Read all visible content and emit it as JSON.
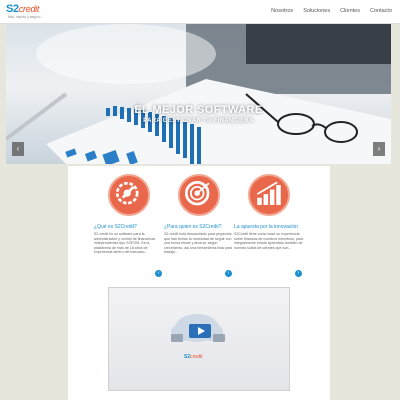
{
  "brand": {
    "logo_main": "S2",
    "logo_accent": "credit",
    "tagline": "fácil, rápido y seguro..."
  },
  "nav": {
    "items": [
      {
        "label": "Nosotros"
      },
      {
        "label": "Soluciones"
      },
      {
        "label": "Clientes"
      },
      {
        "label": "Contacto"
      }
    ]
  },
  "hero": {
    "title": "EL MEJOR SOFTWARE",
    "subtitle": "PARA GESTIONAR TU FINANCIERA",
    "slides_count": 5,
    "active_slide": 2,
    "left_arrow": "‹",
    "right_arrow": "›"
  },
  "features": [
    {
      "icon": "gear-wrench-icon",
      "title": "¿Qué es S2Credit?",
      "text": "S2 credit es un software para la administración y control de financieras independientes tipo SOFOM. Es la plataforma de más de 18 años de experiencia dentro del mercado...",
      "more": "›"
    },
    {
      "icon": "target-icon",
      "title": "¿Para quien es S2Credit?",
      "text": "S2 credit está desarrollado para proyectos que han tenido la necesidad de seguir con una forma eficaz y ahorrar, segun crecimiento, así una herramienta lista para trabajo...",
      "more": "›"
    },
    {
      "icon": "growth-chart-icon",
      "title": "La apuesta por la innovación",
      "text": "S2Credit tiene como base su experiencia sobre finanzas de nuestros miembros, para integralmente brinda aprendido también de nuestra sólida de clientes que son...",
      "more": "›"
    }
  ],
  "video": {
    "logo_main": "S2",
    "logo_accent": "credit",
    "icon": "cloud-play-icon"
  },
  "colors": {
    "brand_blue": "#1d8fd0",
    "accent_orange": "#e8502a",
    "circle_orange": "#e9674a",
    "page_bg": "#e6e6dc"
  }
}
